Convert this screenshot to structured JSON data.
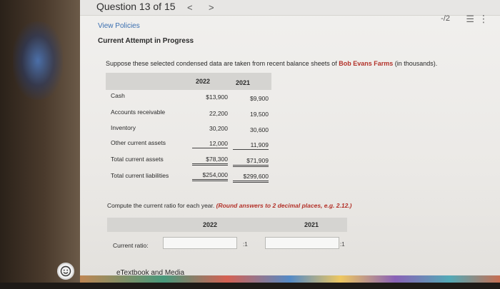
{
  "header": {
    "question_label": "Question 13 of 15",
    "prev_icon": "<",
    "next_icon": ">",
    "score": "-/2",
    "list_icon": "☰",
    "more_icon": "⋮"
  },
  "links": {
    "view_policies": "View Policies"
  },
  "status": {
    "attempt": "Current Attempt in Progress"
  },
  "problem": {
    "prompt_before": "Suppose these selected condensed data are taken from recent balance sheets of ",
    "company": "Bob Evans Farms",
    "prompt_after": " (in thousands).",
    "columns": [
      "2022",
      "2021"
    ],
    "rows": [
      {
        "label": "Cash",
        "v2022": "$13,900",
        "v2021": "$9,900"
      },
      {
        "label": "Accounts receivable",
        "v2022": "22,200",
        "v2021": "19,500"
      },
      {
        "label": "Inventory",
        "v2022": "30,200",
        "v2021": "30,600"
      },
      {
        "label": "Other current assets",
        "v2022": "12,000",
        "v2021": "11,909"
      },
      {
        "label": "Total current assets",
        "v2022": "$78,300",
        "v2021": "$71,909"
      },
      {
        "label": "Total current liabilities",
        "v2022": "$254,000",
        "v2021": "$299,600"
      }
    ],
    "compute_text": "Compute the current ratio for each year. ",
    "compute_hint": "(Round answers to 2 decimal places, e.g. 2.12.)",
    "ratio_columns": [
      "2022",
      "2021"
    ],
    "ratio_label": "Current ratio:",
    "ratio_value_2022": "",
    "ratio_value_2021": "",
    "ratio_suffix": ":1"
  },
  "footer": {
    "etextbook": "eTextbook and Media"
  },
  "colors": {
    "link": "#3a6fb0",
    "accent_red": "#b3322a",
    "header_band": "#d5d4d1"
  }
}
